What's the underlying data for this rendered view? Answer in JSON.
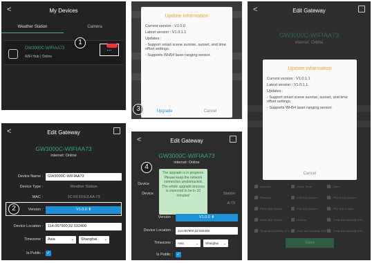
{
  "panel1": {
    "title": "My Devices",
    "back": "<",
    "tabs": [
      "Weather Station",
      "Camera"
    ],
    "device_name": "GW3000C-WIFIAA73",
    "device_sub": "WiFi Hub | Online",
    "more": "...",
    "step": "1"
  },
  "panel2": {
    "modal_title": "Update information",
    "current": "Current version : V1.0.0",
    "latest": "Latest version : V1.0.1.1",
    "updates_label": "Updates :",
    "update1": "- Support smart scene sunrise, sunset, and time offset settings.",
    "update2": "- Supports WH54 laser ranging sensor.",
    "upgrade": "Upgrade",
    "cancel": "Cancel",
    "step": "3"
  },
  "panel3": {
    "title": "Edit Gateway",
    "back": "<",
    "gw_title": "GW3000C-WIFIAA73",
    "gw_sub": "internet: Online",
    "modal_title": "Update information",
    "current": "Current version : V1.0.1.1",
    "latest": "Latest version : V1.0.1.1",
    "updates_label": "Updates :",
    "update1": "- Support smart scene sunrise, sunset, and time offset settings.",
    "update2": "- Supports WH54 laser ranging sensor.",
    "cancel": "Cancel",
    "grid": [
      [
        "Humidity",
        "Indoor Temp",
        "Wind"
      ],
      [
        "Pressure",
        "CO2 AQI Combo",
        "PM2.5 AQI Combo"
      ],
      [
        "PM10 AQI Combo",
        "PM1 AQI Combo",
        "PM4 AQI Combo"
      ],
      [
        "Water AQI Combo",
        "Leaking",
        "Temp and Humidity CH1"
      ],
      [
        "Temp and Humidity CH2",
        "Temp and Humidity CH3",
        "Temp and Humidity CH4"
      ]
    ],
    "save": "Save"
  },
  "panel4": {
    "title": "Edit Gateway",
    "back": "<",
    "gw_title": "GW3000C-WIFIAA73",
    "gw_sub": "internet: Online",
    "name_label": "Device Name :",
    "name_value": "GW3000C-WIFIAA73",
    "type_label": "Device Type :",
    "type_value": "Weather Station",
    "mac_label": "MAC :",
    "mac_value": "1C:69:20:E3:AA:73",
    "version_label": "Version :",
    "version_value": "V1.0.0 ⬆",
    "location_label": "Device Location :",
    "location_value": "114.067900,22.532400",
    "timezone_label": "Timezone :",
    "tz_region": "Asia",
    "tz_city": "Shanghai",
    "public_label": "Is Public :",
    "check": "✓",
    "step": "2"
  },
  "panel5": {
    "title": "Edit Gateway",
    "back": "<",
    "gw_title": "GW3000C-WIFIAA73",
    "gw_sub": "internet: Online",
    "toast": "The upgrade is in progress. Please keep the network connection unobstructed. The whole upgrade process is expected to be in 10 minutes!",
    "device_label_a": "Device",
    "device_label_b": "Device",
    "version_label": "Version :",
    "version_value": "V1.0.0 ⬆",
    "location_label": "Device Location :",
    "location_value": "114.067900,22.532400",
    "timezone_label": "Timezone :",
    "tz_region": "Asia",
    "tz_city": "Shanghai",
    "public_label": "Is Public :",
    "check": "✓",
    "step": "4",
    "partial_mac": "A:73",
    "partial_station": "Station"
  }
}
